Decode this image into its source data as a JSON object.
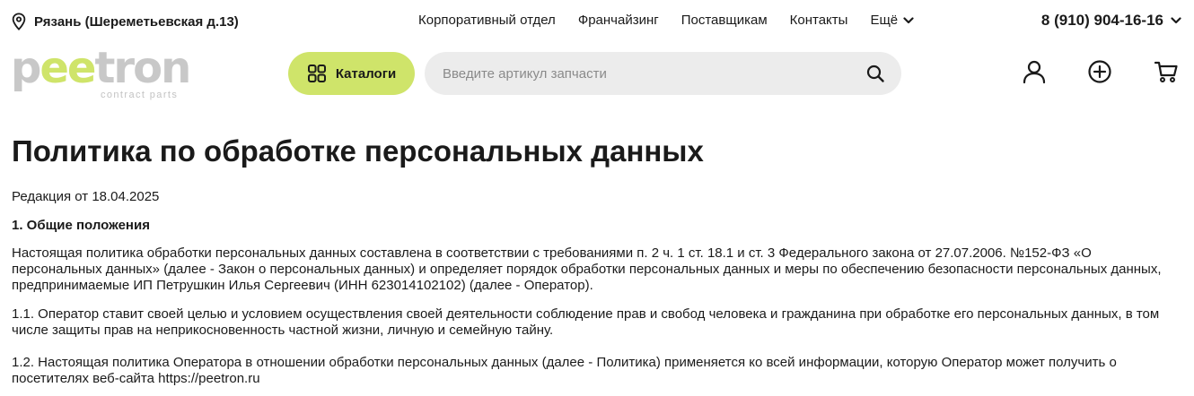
{
  "top_bar": {
    "city": "Рязань (Шереметьевская д.13)",
    "nav": [
      "Корпоративный отдел",
      "Франчайзинг",
      "Поставщикам",
      "Контакты"
    ],
    "more_label": "Ещё",
    "phone": "8 (910) 904-16-16"
  },
  "header": {
    "logo_text": "peetron",
    "logo_subtitle": "contract parts",
    "catalog_label": "Каталоги",
    "search_placeholder": "Введите артикул запчасти",
    "icons": [
      "user-icon",
      "plus-circle-icon",
      "cart-icon"
    ]
  },
  "page": {
    "title": "Политика по обработке персональных данных",
    "edition": "Редакция от 18.04.2025",
    "section_1_title": "1. Общие положения",
    "paragraph_1": "Настоящая политика обработки персональных данных составлена в соответствии с требованиями п. 2 ч. 1 ст. 18.1 и ст. 3 Федерального закона от 27.07.2006. №152-ФЗ «О персональных данных» (далее - Закон о персональных данных) и определяет порядок обработки персональных данных и меры по обеспечению безопасности персональных данных, предпринимаемые ИП Петрушкин Илья Сергеевич (ИНН 623014102102) (далее - Оператор).",
    "paragraph_1_1": "1.1. Оператор ставит своей целью и условием осуществления своей деятельности соблюдение прав и свобод человека и гражданина при обработке его персональных данных, в том числе защиты прав на неприкосновенность частной жизни, личную и семейную тайну.",
    "paragraph_1_2": "1.2. Настоящая политика Оператора в отношении обработки персональных данных (далее - Политика) применяется ко всей информации, которую Оператор может получить о посетителях веб-сайта https://peetron.ru"
  },
  "colors": {
    "accent": "#cfe46a",
    "search_bg": "#ececec",
    "text": "#1a1a1a",
    "logo_gray": "#c8c8c8"
  }
}
